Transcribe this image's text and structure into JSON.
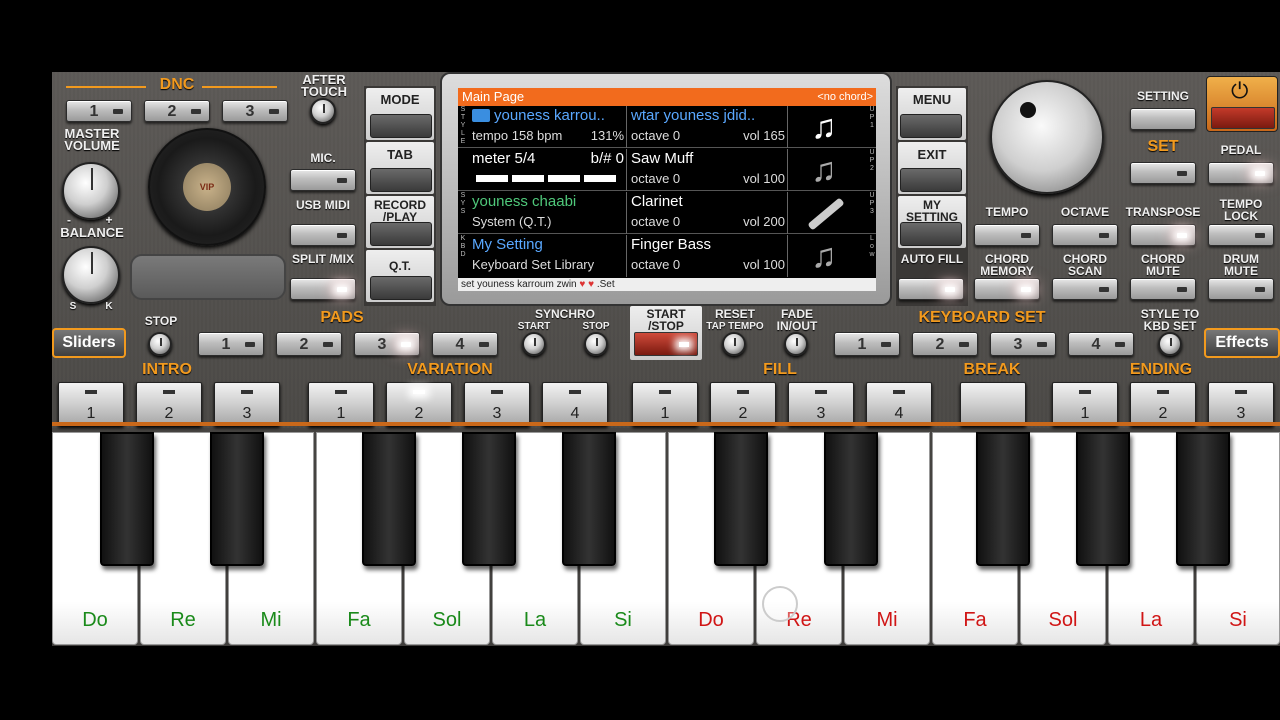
{
  "top": {
    "dnc": "DNC",
    "after_touch": "AFTER TOUCH",
    "master_volume": "MASTER VOLUME",
    "balance": "BALANCE",
    "bal_minus": "-",
    "bal_plus": "+",
    "bal_s": "S",
    "bal_k": "K",
    "mic": "MIC.",
    "usb_midi": "USB MIDI",
    "split_mix": "SPLIT /MIX",
    "dnc_buttons": [
      "1",
      "2",
      "3"
    ],
    "vip": "VIP"
  },
  "left_col": {
    "mode": "MODE",
    "tab": "TAB",
    "record_play": "RECORD /PLAY",
    "qt": "Q.T."
  },
  "screen": {
    "header": "Main Page",
    "no_chord": "<no chord>",
    "rows": [
      {
        "side": "S T Y L E",
        "name": "youness karrou..",
        "info": "tempo 158 bpm",
        "pct": "131%",
        "voice": "wtar youness jdid..",
        "octave": "octave  0",
        "vol": "vol 165",
        "up": "U P 1"
      },
      {
        "side": "",
        "name": "meter 5/4",
        "info": "",
        "pct": "b/#  0",
        "voice": "Saw Muff",
        "octave": "octave  0",
        "vol": "vol 100",
        "up": "U P 2"
      },
      {
        "side": "S Y S",
        "name": "youness chaabi",
        "info": "System (Q.T.)",
        "pct": "",
        "voice": "Clarinet",
        "octave": "octave  0",
        "vol": "vol 200",
        "up": "U P 3"
      },
      {
        "side": "K B D",
        "name": "My Setting",
        "info": "Keyboard Set Library",
        "pct": "",
        "voice": "Finger Bass",
        "octave": "octave  0",
        "vol": "vol 100",
        "up": "L o w"
      }
    ],
    "footer": "set youness karroum zwin",
    "footer_end": ".Set"
  },
  "right_col": {
    "menu": "MENU",
    "exit": "EXIT",
    "my_setting": "MY SETTING",
    "auto_fill": "AUTO FILL"
  },
  "right": {
    "setting": "SETTING",
    "set": "SET",
    "pedal": "PEDAL",
    "tempo": "TEMPO",
    "octave": "OCTAVE",
    "transpose": "TRANSPOSE",
    "tempo_lock": "TEMPO LOCK",
    "chord_memory": "CHORD MEMORY",
    "chord_scan": "CHORD SCAN",
    "chord_mute": "CHORD MUTE",
    "drum_mute": "DRUM MUTE"
  },
  "mid": {
    "sliders": "Sliders",
    "stop": "STOP",
    "pads": "PADS",
    "pad_buttons": [
      "1",
      "2",
      "3",
      "4"
    ],
    "synchro": "SYNCHRO",
    "sync_start": "START",
    "sync_stop": "STOP",
    "start_stop": "START /STOP",
    "reset": "RESET",
    "tap_tempo": "TAP TEMPO",
    "fade": "FADE IN/OUT",
    "keyboard_set": "KEYBOARD SET",
    "kbd_buttons": [
      "1",
      "2",
      "3",
      "4"
    ],
    "style_to_kbd": "STYLE TO KBD SET",
    "effects": "Effects"
  },
  "row3": {
    "intro": "INTRO",
    "variation": "VARIATION",
    "fill": "FILL",
    "break": "BREAK",
    "ending": "ENDING",
    "intro_btns": [
      "1",
      "2",
      "3"
    ],
    "var_btns": [
      "1",
      "2",
      "3",
      "4"
    ],
    "fill_btns": [
      "1",
      "2",
      "3",
      "4"
    ],
    "end_btns": [
      "1",
      "2",
      "3"
    ]
  },
  "keys": [
    "Do",
    "Re",
    "Mi",
    "Fa",
    "Sol",
    "La",
    "Si",
    "Do",
    "Re",
    "Mi",
    "Fa",
    "Sol",
    "La",
    "Si"
  ],
  "colors": {
    "green_key": "#1a8a1a",
    "red_key": "#d01515",
    "orange": "#f29a1e"
  }
}
